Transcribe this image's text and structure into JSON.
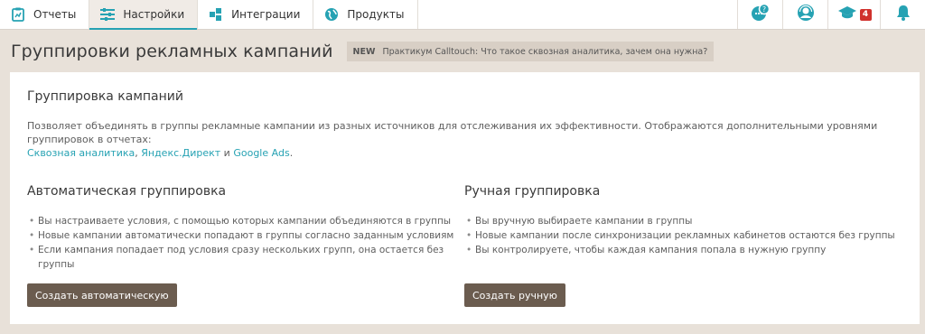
{
  "nav": {
    "tabs": [
      {
        "label": "Отчеты",
        "icon": "clipboard-chart-icon"
      },
      {
        "label": "Настройки",
        "icon": "sliders-icon",
        "active": true
      },
      {
        "label": "Интеграции",
        "icon": "puzzle-icon"
      },
      {
        "label": "Продукты",
        "icon": "globe-icon"
      }
    ],
    "tools": {
      "support_icon": "support-chat-icon",
      "manager_icon": "manager-headset-icon",
      "academy_icon": "graduation-cap-icon",
      "academy_badge": "4",
      "notifications_icon": "bell-icon"
    },
    "accent": "#26a2b3"
  },
  "header": {
    "title": "Группировки рекламных кампаний",
    "news_tag": "NEW",
    "news_text": "Практикум Calltouch: Что такое сквозная аналитика, зачем она нужна?"
  },
  "card": {
    "title": "Группировка кампаний",
    "description": "Позволяет объединять в группы рекламные кампании из разных источников для отслеживания их эффективности. Отображаются дополнительными уровнями группировок в отчетах:",
    "links": [
      "Сквозная аналитика",
      "Яндекс.Директ",
      "Google Ads"
    ],
    "link_sep1": ", ",
    "link_sep2": " и ",
    "link_end": ".",
    "auto": {
      "title": "Автоматическая группировка",
      "items": [
        "Вы настраиваете условия, с помощью которых кампании объединяются в группы",
        "Новые кампании автоматически попадают в группы согласно заданным условиям",
        "Если кампания попадает под условия сразу нескольких групп, она остается без группы"
      ],
      "button": "Создать автоматическую"
    },
    "manual": {
      "title": "Ручная группировка",
      "items": [
        "Вы вручную выбираете кампании в группы",
        "Новые кампании после синхронизации рекламных кабинетов остаются без группы",
        "Вы контролируете, чтобы каждая кампания попала в нужную группу"
      ],
      "button": "Создать ручную"
    }
  }
}
